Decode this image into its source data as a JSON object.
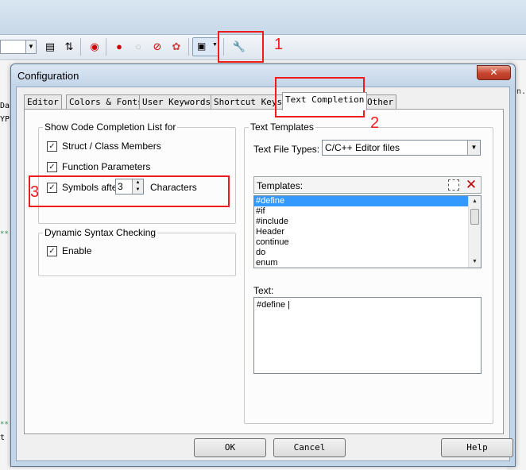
{
  "background": {
    "gutter_lines": [
      "Da",
      "YPE",
      "t"
    ],
    "tab_stub": "n.c"
  },
  "toolbar": {
    "icons": [
      "combo-dropdown",
      "file-icon",
      "bookmark-icon",
      "debug-icon",
      "breakpoint-red-icon",
      "breakpoint-empty-icon",
      "breakpoints-icon",
      "kill-breakpoints-icon",
      "window-dropdown-icon",
      "configuration-wrench-icon"
    ]
  },
  "dialog": {
    "title": "Configuration",
    "close_label": "✕",
    "tabs": [
      "Editor",
      "Colors & Fonts",
      "User Keywords",
      "Shortcut Keys",
      "Text Completion",
      "Other"
    ],
    "active_tab": "Text Completion",
    "completion_group": {
      "title": "Show Code Completion List for",
      "struct_label": "Struct / Class Members",
      "function_label": "Function Parameters",
      "symbols_label": "Symbols after",
      "symbols_value": "3",
      "characters_label": "Characters",
      "struct_checked": true,
      "function_checked": true,
      "symbols_checked": true
    },
    "syntax_group": {
      "title": "Dynamic Syntax Checking",
      "enable_label": "Enable",
      "enable_checked": true
    },
    "templates_group": {
      "title": "Text Templates",
      "file_types_label": "Text File Types:",
      "file_types_value": "C/C++ Editor files",
      "templates_label": "Templates:",
      "templates": [
        "#define",
        "#if",
        "#include",
        "Header",
        "continue",
        "do",
        "enum"
      ],
      "selected_template": "#define",
      "text_label": "Text:",
      "text_value": "#define |"
    },
    "buttons": {
      "ok": "OK",
      "cancel": "Cancel",
      "help": "Help"
    }
  },
  "annotations": {
    "label_1": "1",
    "label_2": "2",
    "label_3": "3",
    "color": "#ee1c1c"
  }
}
